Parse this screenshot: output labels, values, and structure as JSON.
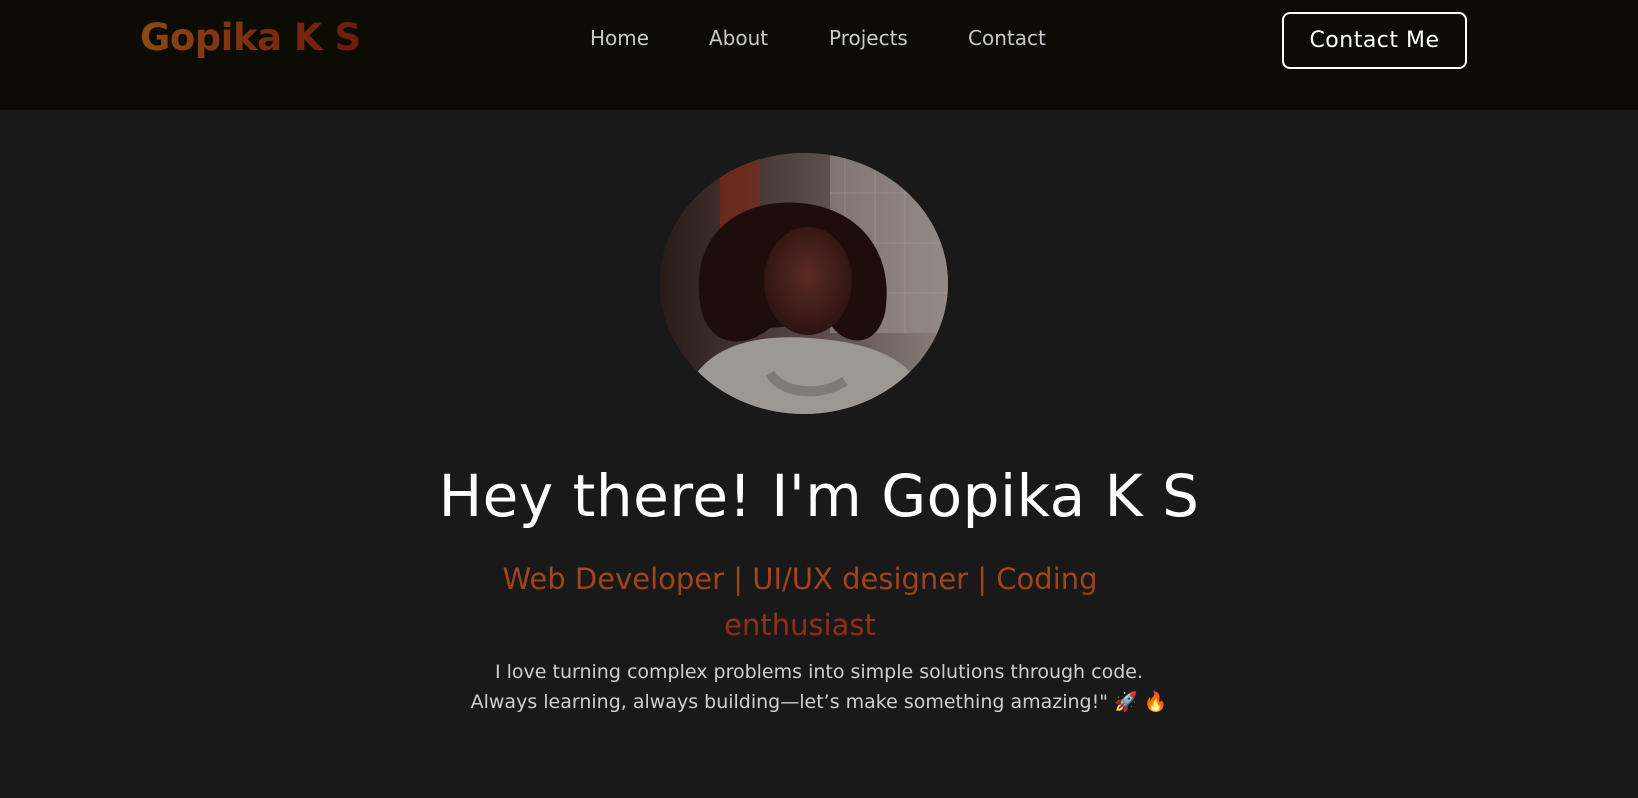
{
  "header": {
    "logo": "Gopika K S",
    "nav": [
      {
        "label": "Home"
      },
      {
        "label": "About"
      },
      {
        "label": "Projects"
      },
      {
        "label": "Contact"
      }
    ],
    "cta_label": "Contact Me"
  },
  "hero": {
    "avatar_icon": "profile-photo",
    "headline": "Hey there! I'm Gopika K S",
    "subtitle": "Web Developer | UI/UX designer | Coding enthusiast",
    "bio_line1": "I love turning complex problems into simple solutions through code.",
    "bio_line2": "Always learning, always building—let’s make something amazing!\" 🚀 🔥"
  },
  "colors": {
    "page_bg": "#191919",
    "nav_bg": "#0c0c05",
    "accent_start": "#8a4a14",
    "accent_end": "#6e1c0c",
    "text_primary": "#ffffff",
    "text_muted": "#cfcfcf"
  }
}
